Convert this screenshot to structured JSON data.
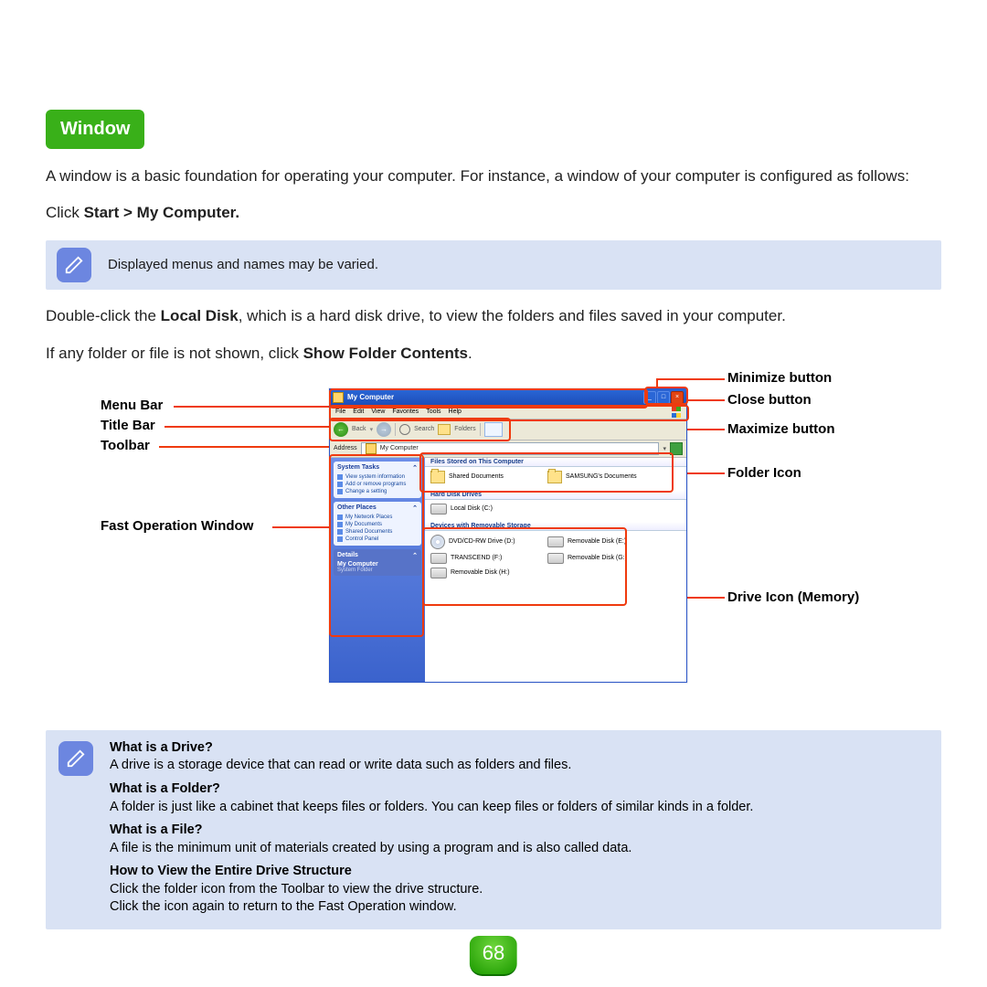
{
  "section_title": "Window",
  "intro": "A window is a basic foundation for operating your computer. For instance, a window of your computer is configured as follows:",
  "instruction_prefix": "Click ",
  "instruction_bold": "Start > My Computer.",
  "note1": "Displayed menus and names may be varied.",
  "after_note_1a": "Double-click the ",
  "after_note_1b": "Local Disk",
  "after_note_1c": ", which is a hard disk drive, to view the folders and files saved in your computer.",
  "after_note_2a": "If any folder or file is not shown, click ",
  "after_note_2b": "Show Folder Contents",
  "after_note_2c": ".",
  "callouts": {
    "left": [
      "Menu Bar",
      "Title Bar",
      "Toolbar",
      "Fast Operation Window"
    ],
    "right": [
      "Minimize button",
      "Close button",
      "Maximize button",
      "Folder Icon",
      "Drive Icon (Memory)"
    ]
  },
  "xp": {
    "title": "My Computer",
    "menu": [
      "File",
      "Edit",
      "View",
      "Favorites",
      "Tools",
      "Help"
    ],
    "toolbar": {
      "back": "Back",
      "search": "Search",
      "folders": "Folders"
    },
    "address_label": "Address",
    "address": "My Computer",
    "side": {
      "tasks_h": "System Tasks",
      "tasks": [
        "View system information",
        "Add or remove programs",
        "Change a setting"
      ],
      "places_h": "Other Places",
      "places": [
        "My Network Places",
        "My Documents",
        "Shared Documents",
        "Control Panel"
      ],
      "details_h": "Details",
      "details_t": "My Computer",
      "details_s": "System Folder"
    },
    "groups": [
      {
        "h": "Files Stored on This Computer",
        "items": [
          {
            "t": "folder",
            "n": "Shared Documents"
          },
          {
            "t": "folder",
            "n": "SAMSUNG's Documents"
          }
        ]
      },
      {
        "h": "Hard Disk Drives",
        "items": [
          {
            "t": "disk",
            "n": "Local Disk (C:)"
          }
        ]
      },
      {
        "h": "Devices with Removable Storage",
        "items": [
          {
            "t": "cd",
            "n": "DVD/CD-RW Drive (D:)"
          },
          {
            "t": "disk",
            "n": "Removable Disk (E:)"
          },
          {
            "t": "disk",
            "n": "TRANSCEND (F:)"
          },
          {
            "t": "disk",
            "n": "Removable Disk (G:)"
          },
          {
            "t": "disk",
            "n": "Removable Disk (H:)"
          }
        ]
      }
    ]
  },
  "info": {
    "q1": "What is a Drive?",
    "a1": "A drive is a storage device that can read or write data such as folders and files.",
    "q2": "What is a Folder?",
    "a2": "A folder is just like a cabinet that keeps files or folders. You can keep files or folders of similar kinds in a folder.",
    "q3": "What is a File?",
    "a3": "A file is the minimum unit of materials created by using a program and is also called data.",
    "q4": "How to View the Entire Drive Structure",
    "a4a": "Click the folder icon from the Toolbar to view the drive structure.",
    "a4b": "Click the icon again to return to the Fast Operation window."
  },
  "page_number": "68"
}
